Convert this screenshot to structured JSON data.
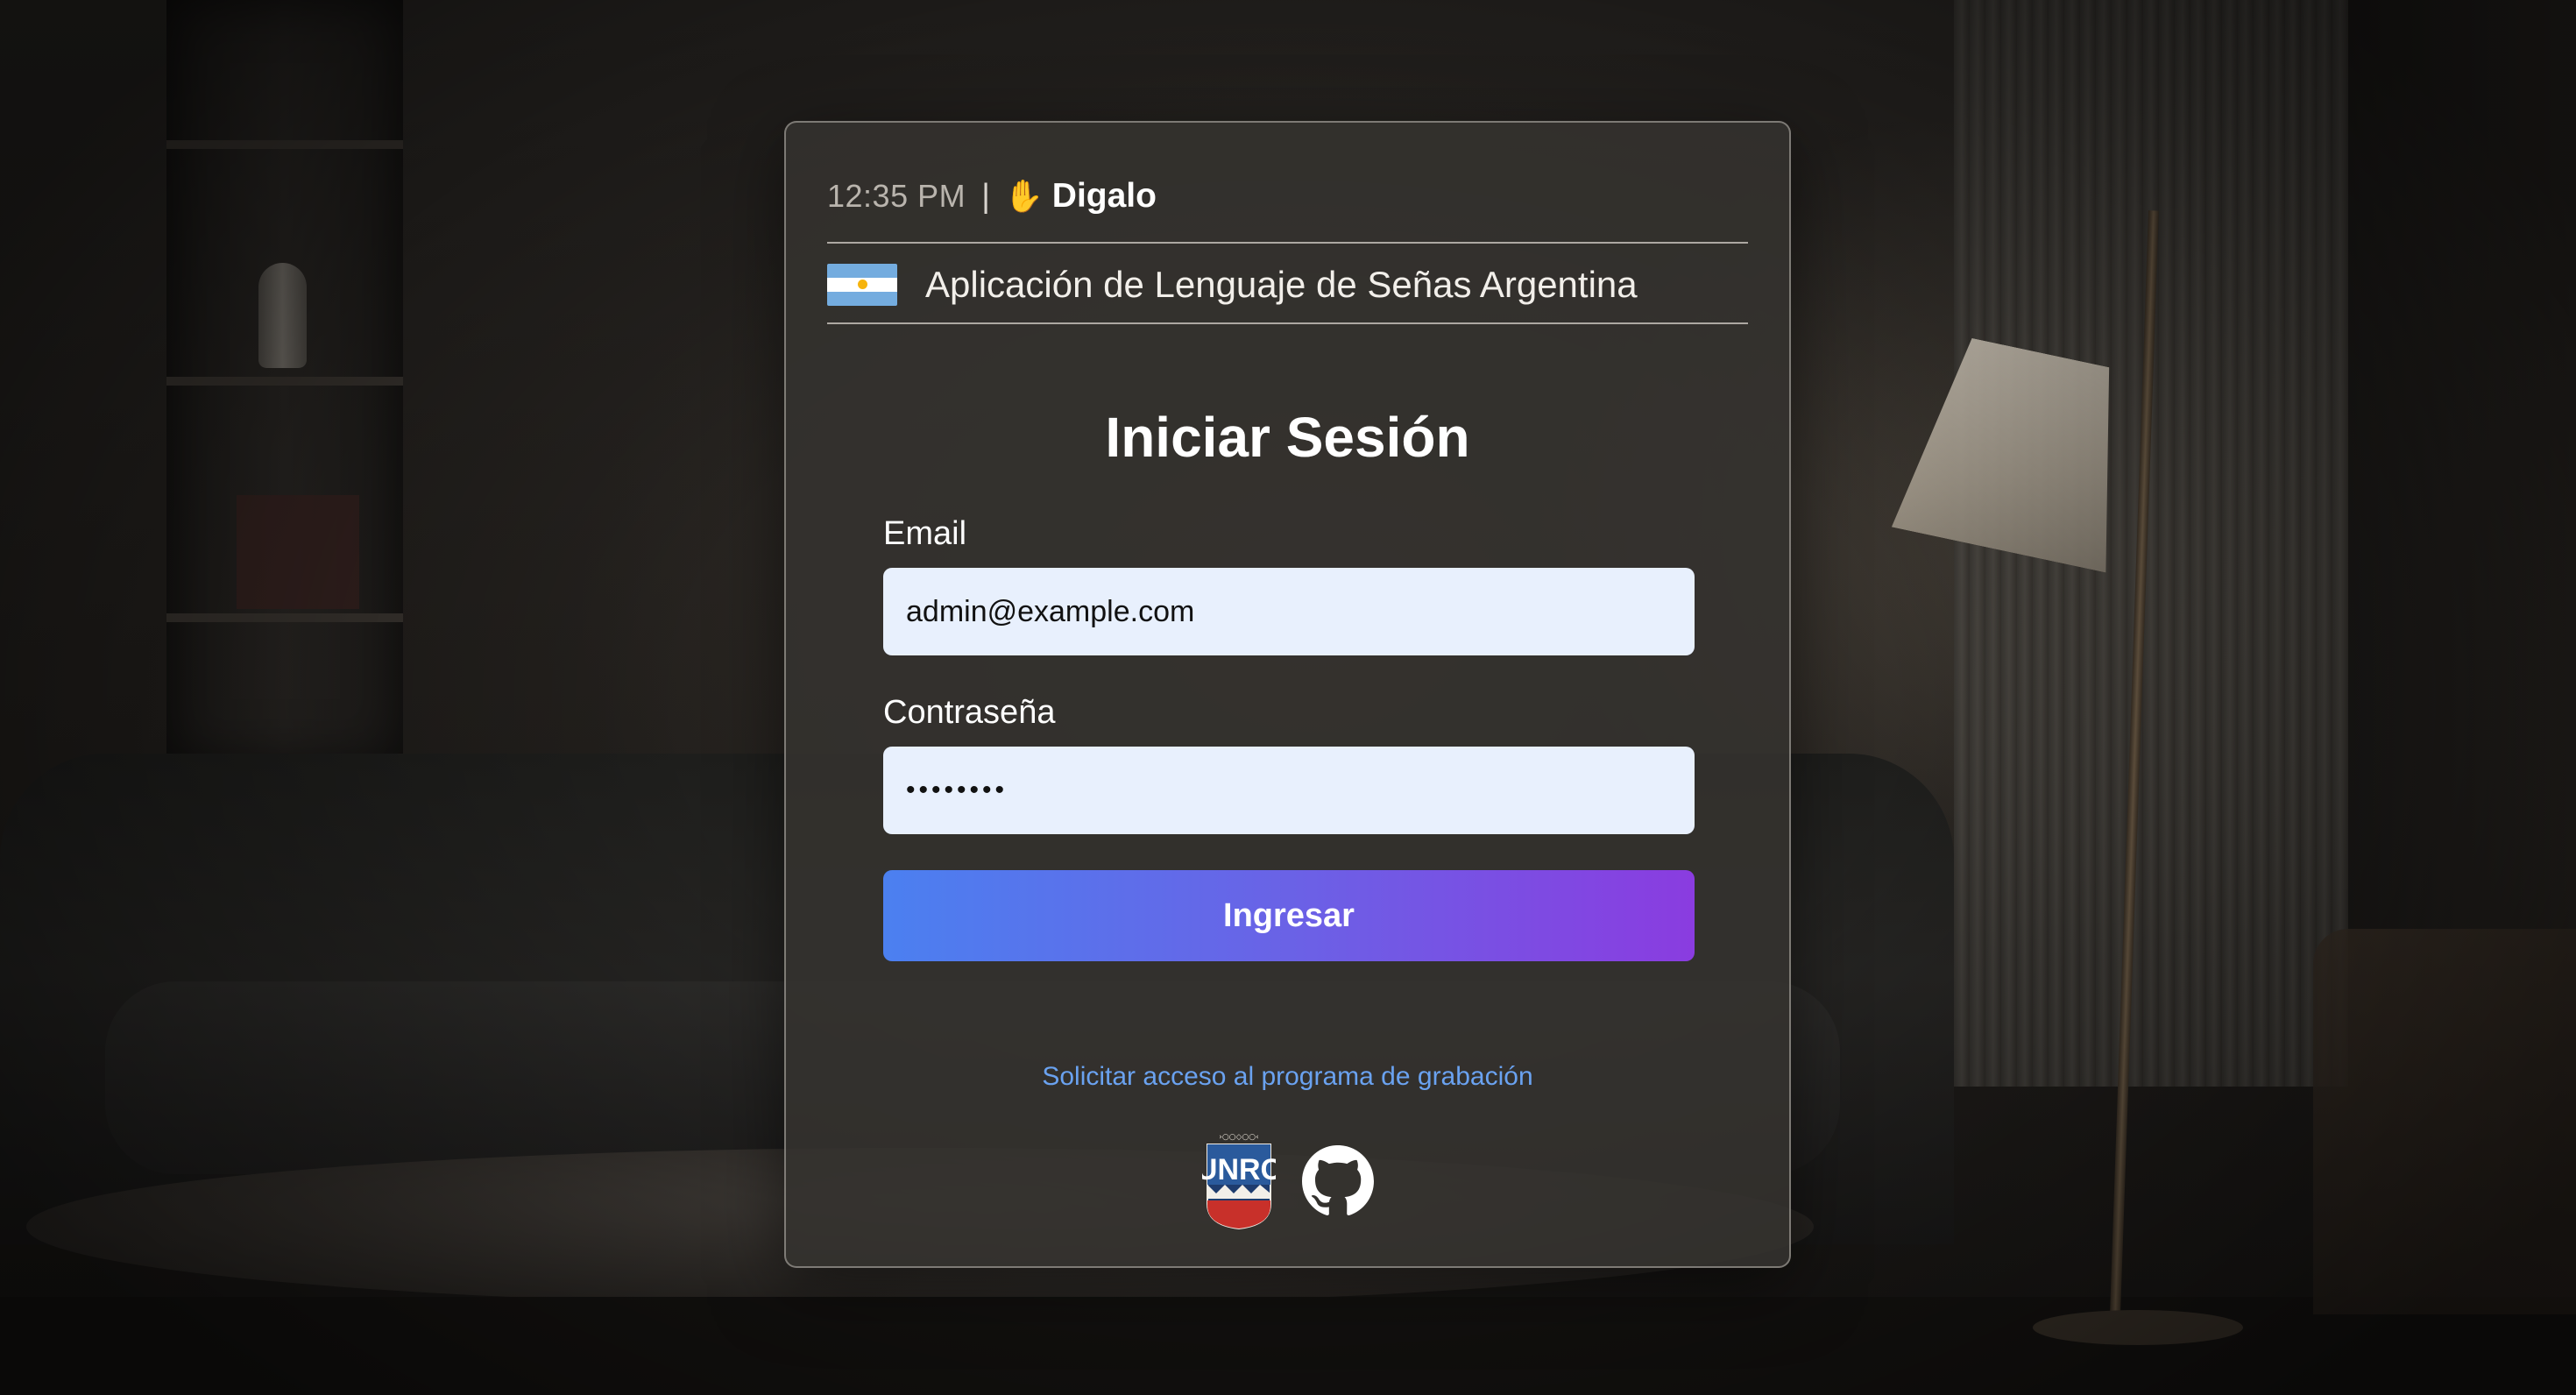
{
  "header": {
    "time": "12:35 PM",
    "separator": "|",
    "brand_icon": "raised-hand-emoji",
    "brand_icon_glyph": "✋",
    "brand_name": "Digalo",
    "flag_icon": "argentina-flag-icon",
    "subtitle": "Aplicación de Lenguaje de Señas Argentina"
  },
  "login": {
    "title": "Iniciar Sesión",
    "email_label": "Email",
    "email_value": "admin@example.com",
    "password_label": "Contraseña",
    "password_value": "••••••••",
    "submit_label": "Ingresar"
  },
  "footer": {
    "request_link": "Solicitar acceso al programa de grabación",
    "logos": [
      "unrc-logo",
      "github-icon"
    ],
    "unrc_logo_text": "UNRC"
  },
  "colors": {
    "button_gradient_start": "#4b80f0",
    "button_gradient_end": "#8a3ce0",
    "link": "#6aa2f0",
    "input_background": "#e8f0fd",
    "card_background": "#34322f"
  }
}
